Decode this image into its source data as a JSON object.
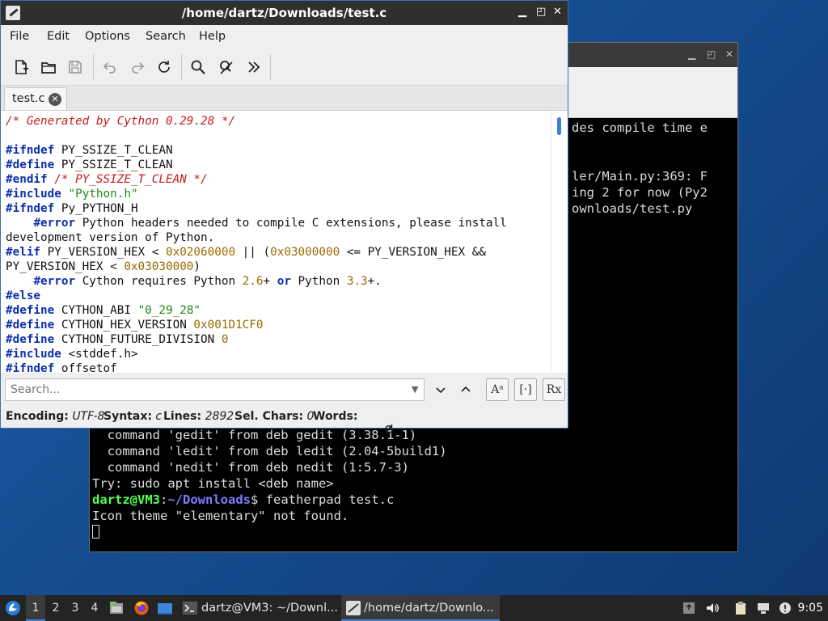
{
  "terminal": {
    "visible_fragments": [
      "des compile time e",
      "ler/Main.py:369: F",
      "ing 2 for now (Py2",
      "ownloads/test.py"
    ],
    "lines": [
      "  command 'gedit' from deb gedit (3.38.1-1)",
      "  command 'ledit' from deb ledit (2.04-5build1)",
      "  command 'nedit' from deb nedit (1:5.7-3)",
      "Try: sudo apt install <deb name>"
    ],
    "prompt_user": "dartz@VM3",
    "prompt_sep": ":",
    "prompt_path": "~/Downloads",
    "prompt_end": "$ ",
    "command": "featherpad test.c",
    "output": "Icon theme \"elementary\" not found."
  },
  "editor_window": {
    "title": "/home/dartz/Downloads/test.c",
    "menus": [
      "File",
      "Edit",
      "Options",
      "Search",
      "Help"
    ],
    "toolbar_icons": [
      "new-file-icon",
      "open-folder-icon",
      "save-icon",
      "undo-icon",
      "redo-icon",
      "reload-icon",
      "find-icon",
      "replace-icon",
      "more-icon"
    ],
    "tab": {
      "label": "test.c"
    },
    "search": {
      "placeholder": "Search...",
      "opt_case": "Aᵃ",
      "opt_whole": "[·]",
      "opt_regex": "Rx"
    },
    "status": {
      "encoding_label": "Encoding:",
      "encoding_value": "UTF-8",
      "syntax_label": "Syntax:",
      "syntax_value": "c",
      "lines_label": "Lines:",
      "lines_value": "2892",
      "selchars_label": "Sel. Chars:",
      "selchars_value": "0",
      "words_label": "Words:"
    },
    "code": [
      [
        {
          "t": "/* Generated by Cython 0.29.28 */",
          "c": "comment"
        }
      ],
      [],
      [
        {
          "t": "#ifndef",
          "c": "pre"
        },
        {
          "t": " PY_SSIZE_T_CLEAN"
        }
      ],
      [
        {
          "t": "#define",
          "c": "pre"
        },
        {
          "t": " PY_SSIZE_T_CLEAN"
        }
      ],
      [
        {
          "t": "#endif",
          "c": "pre"
        },
        {
          "t": " "
        },
        {
          "t": "/* PY_SSIZE_T_CLEAN */",
          "c": "comment"
        }
      ],
      [
        {
          "t": "#include",
          "c": "pre"
        },
        {
          "t": " "
        },
        {
          "t": "\"Python.h\"",
          "c": "str"
        }
      ],
      [
        {
          "t": "#ifndef",
          "c": "pre"
        },
        {
          "t": " Py_PYTHON_H"
        }
      ],
      [
        {
          "t": "    "
        },
        {
          "t": "#error",
          "c": "pre"
        },
        {
          "t": " Python headers needed to compile C extensions, please install"
        }
      ],
      [
        {
          "t": "development version of Python."
        }
      ],
      [
        {
          "t": "#elif",
          "c": "pre"
        },
        {
          "t": " PY_VERSION_HEX < "
        },
        {
          "t": "0x02060000",
          "c": "num"
        },
        {
          "t": " || ("
        },
        {
          "t": "0x03000000",
          "c": "num"
        },
        {
          "t": " <= PY_VERSION_HEX &&"
        }
      ],
      [
        {
          "t": "PY_VERSION_HEX < "
        },
        {
          "t": "0x03030000",
          "c": "num"
        },
        {
          "t": ")"
        }
      ],
      [
        {
          "t": "    "
        },
        {
          "t": "#error",
          "c": "pre"
        },
        {
          "t": " Cython requires Python "
        },
        {
          "t": "2.6",
          "c": "num"
        },
        {
          "t": "+ "
        },
        {
          "t": "or",
          "c": "kw"
        },
        {
          "t": " Python "
        },
        {
          "t": "3.3",
          "c": "num"
        },
        {
          "t": "+."
        }
      ],
      [
        {
          "t": "#else",
          "c": "pre"
        }
      ],
      [
        {
          "t": "#define",
          "c": "pre"
        },
        {
          "t": " CYTHON_ABI "
        },
        {
          "t": "\"0_29_28\"",
          "c": "str"
        }
      ],
      [
        {
          "t": "#define",
          "c": "pre"
        },
        {
          "t": " CYTHON_HEX_VERSION "
        },
        {
          "t": "0x001D1CF0",
          "c": "num"
        }
      ],
      [
        {
          "t": "#define",
          "c": "pre"
        },
        {
          "t": " CYTHON_FUTURE_DIVISION "
        },
        {
          "t": "0",
          "c": "num"
        }
      ],
      [
        {
          "t": "#include",
          "c": "pre"
        },
        {
          "t": " <stddef.h>"
        }
      ],
      [
        {
          "t": "#ifndef",
          "c": "pre"
        },
        {
          "t": " offsetof"
        }
      ]
    ]
  },
  "taskbar": {
    "workspaces": [
      "1",
      "2",
      "3",
      "4"
    ],
    "tasks": [
      {
        "label": "dartz@VM3: ~/Downl..."
      },
      {
        "label": "/home/dartz/Downlo..."
      }
    ],
    "clock": "9:05"
  }
}
